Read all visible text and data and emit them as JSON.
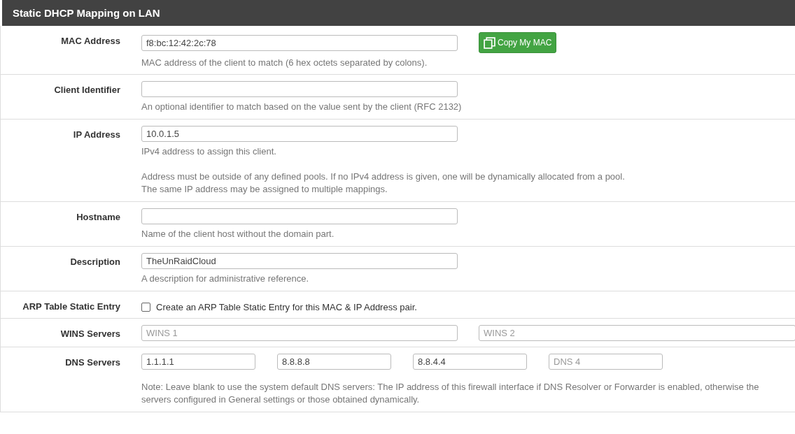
{
  "panel": {
    "title": "Static DHCP Mapping on LAN"
  },
  "rows": [
    {
      "kind": "text",
      "label": "MAC Address",
      "value": "f8:bc:12:42:2c:78",
      "button": "Copy My MAC",
      "help": [
        [
          "MAC address of the client to match (6 hex octets separated by colons)."
        ]
      ]
    },
    {
      "kind": "text",
      "label": "Client Identifier",
      "value": "",
      "help": [
        [
          "An optional identifier to match based on the value sent by the client (RFC 2132)"
        ]
      ]
    },
    {
      "kind": "text",
      "label": "IP Address",
      "value": "10.0.1.5",
      "help": [
        [
          "IPv4 address to assign this client."
        ],
        [
          "Address must be outside of any defined pools. If no IPv4 address is given, one will be dynamically allocated from a pool.",
          "The same IP address may be assigned to multiple mappings."
        ]
      ]
    },
    {
      "kind": "text",
      "label": "Hostname",
      "value": "",
      "help": [
        [
          "Name of the client host without the domain part."
        ]
      ]
    },
    {
      "kind": "text",
      "label": "Description",
      "value": "TheUnRaidCloud",
      "help": [
        [
          "A description for administrative reference."
        ]
      ]
    },
    {
      "kind": "checkbox",
      "label": "ARP Table Static Entry",
      "checked": false,
      "text": "Create an ARP Table Static Entry for this MAC & IP Address pair."
    },
    {
      "kind": "wide",
      "label": "WINS Servers",
      "inputs": [
        {
          "placeholder": "WINS 1"
        },
        {
          "placeholder": "WINS 2"
        }
      ]
    },
    {
      "kind": "narrow",
      "label": "DNS Servers",
      "inputs": [
        {
          "value": "1.1.1.1"
        },
        {
          "value": "8.8.8.8"
        },
        {
          "value": "8.8.4.4"
        },
        {
          "placeholder": "DNS 4"
        }
      ],
      "help": [
        [
          "Note: Leave blank to use the system default DNS servers: The IP address of this firewall interface if DNS Resolver or Forwarder is enabled, otherwise the servers configured in General settings or those obtained dynamically."
        ]
      ]
    }
  ]
}
